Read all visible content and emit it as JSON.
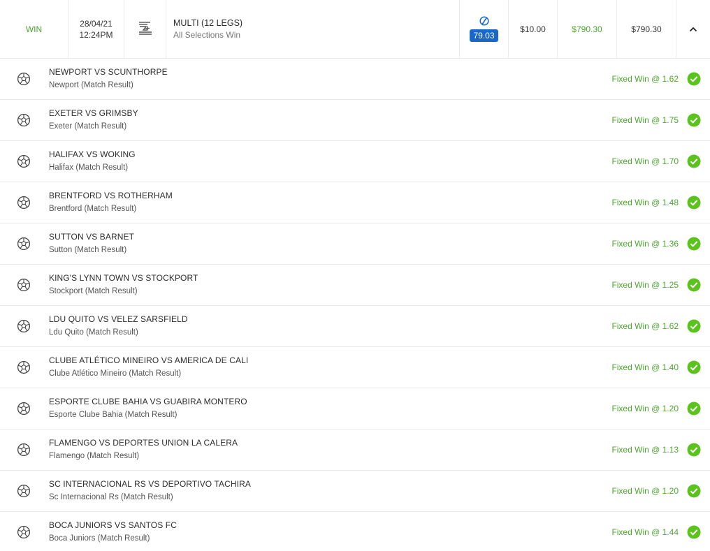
{
  "header": {
    "status": "WIN",
    "date": "28/04/21",
    "time": "12:24PM",
    "bet_type_icon": "multi-bet-icon",
    "title": "MULTI (12 LEGS)",
    "subtitle": "All Selections Win",
    "odds_icon": "promo-disc-icon",
    "odds": "79.03",
    "stake": "$10.00",
    "return": "$790.30",
    "payout": "$790.30",
    "toggle_icon": "chevron-up-icon",
    "colors": {
      "win_green": "#4ba82e",
      "odds_blue": "#1768c9",
      "check_green": "#5cc21e"
    }
  },
  "legs": [
    {
      "event": "NEWPORT VS SCUNTHORPE",
      "selection": "Newport (Match Result)",
      "result": "Fixed Win @ 1.62"
    },
    {
      "event": "EXETER VS GRIMSBY",
      "selection": "Exeter (Match Result)",
      "result": "Fixed Win @ 1.75"
    },
    {
      "event": "HALIFAX VS WOKING",
      "selection": "Halifax (Match Result)",
      "result": "Fixed Win @ 1.70"
    },
    {
      "event": "BRENTFORD VS ROTHERHAM",
      "selection": "Brentford (Match Result)",
      "result": "Fixed Win @ 1.48"
    },
    {
      "event": "SUTTON VS BARNET",
      "selection": "Sutton (Match Result)",
      "result": "Fixed Win @ 1.36"
    },
    {
      "event": "KING'S LYNN TOWN VS STOCKPORT",
      "selection": "Stockport (Match Result)",
      "result": "Fixed Win @ 1.25"
    },
    {
      "event": "LDU QUITO VS VELEZ SARSFIELD",
      "selection": "Ldu Quito (Match Result)",
      "result": "Fixed Win @ 1.62"
    },
    {
      "event": "CLUBE ATLÉTICO MINEIRO VS AMERICA DE CALI",
      "selection": "Clube Atlético Mineiro (Match Result)",
      "result": "Fixed Win @ 1.40"
    },
    {
      "event": "ESPORTE CLUBE BAHIA VS GUABIRA MONTERO",
      "selection": "Esporte Clube Bahia (Match Result)",
      "result": "Fixed Win @ 1.20"
    },
    {
      "event": "FLAMENGO VS DEPORTES UNION LA CALERA",
      "selection": "Flamengo (Match Result)",
      "result": "Fixed Win @ 1.13"
    },
    {
      "event": "SC INTERNACIONAL RS VS DEPORTIVO TACHIRA",
      "selection": "Sc Internacional Rs (Match Result)",
      "result": "Fixed Win @ 1.20"
    },
    {
      "event": "BOCA JUNIORS VS SANTOS FC",
      "selection": "Boca Juniors (Match Result)",
      "result": "Fixed Win @ 1.44"
    }
  ],
  "leg_icon": "soccer-ball-icon",
  "leg_status_icon": "check-circle-icon"
}
